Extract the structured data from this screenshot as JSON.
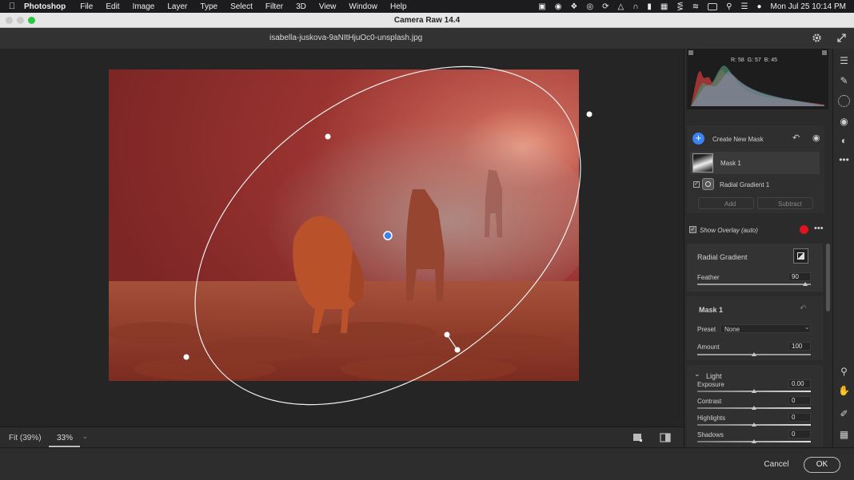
{
  "menubar": {
    "app": "Photoshop",
    "items": [
      "File",
      "Edit",
      "Image",
      "Layer",
      "Type",
      "Select",
      "Filter",
      "3D",
      "View",
      "Window",
      "Help"
    ],
    "clock": "Mon Jul 25  10:14 PM"
  },
  "window": {
    "title": "Camera Raw 14.4"
  },
  "header": {
    "filename": "isabella-juskova-9aNItHjuOc0-unsplash.jpg"
  },
  "histogram": {
    "r_label": "R:",
    "r": "58",
    "g_label": "G:",
    "g": "57",
    "b_label": "B:",
    "b": "45"
  },
  "masks": {
    "create_label": "Create New Mask",
    "mask_name": "Mask 1",
    "component_name": "Radial Gradient 1",
    "add_label": "Add",
    "subtract_label": "Subtract",
    "show_overlay_label": "Show Overlay (auto)",
    "overlay_color": "#e0141e"
  },
  "radial": {
    "title": "Radial Gradient",
    "feather_label": "Feather",
    "feather_value": "90",
    "feather_fraction": 0.95
  },
  "mask_section": {
    "title": "Mask 1",
    "preset_label": "Preset",
    "preset_value": "None",
    "amount_label": "Amount",
    "amount_value": "100",
    "amount_fraction": 0.5
  },
  "light": {
    "title": "Light",
    "sliders": [
      {
        "label": "Exposure",
        "value": "0.00",
        "fraction": 0.5
      },
      {
        "label": "Contrast",
        "value": "0",
        "fraction": 0.5
      },
      {
        "label": "Highlights",
        "value": "0",
        "fraction": 0.5
      },
      {
        "label": "Shadows",
        "value": "0",
        "fraction": 0.5
      }
    ]
  },
  "zoom": {
    "fit_label": "Fit (39%)",
    "zoom_value": "33%"
  },
  "footer": {
    "cancel": "Cancel",
    "ok": "OK"
  },
  "accent_color": "#3b82f6"
}
